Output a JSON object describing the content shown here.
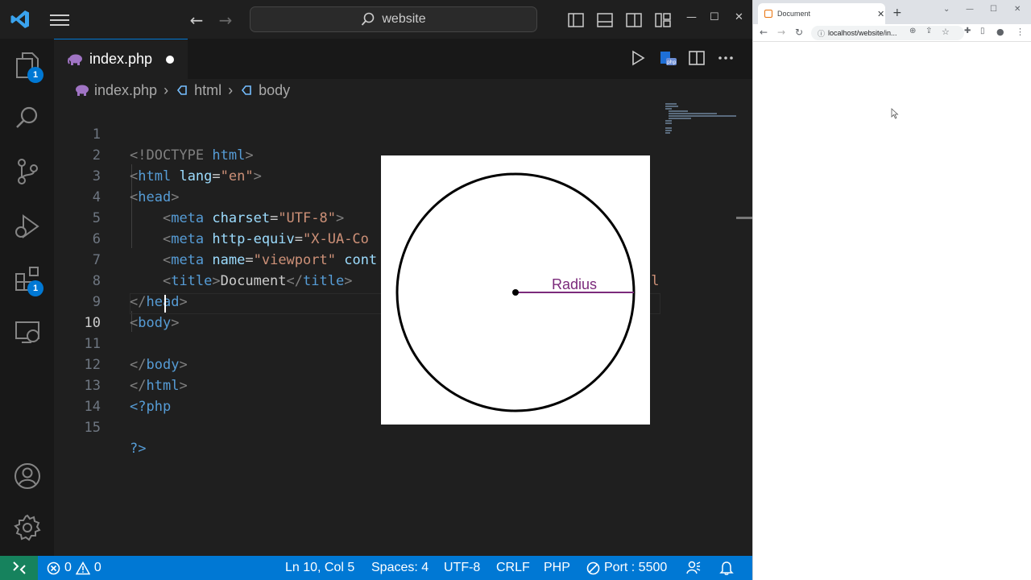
{
  "vscode": {
    "search_text": "website",
    "explorer_badge": "1",
    "extensions_badge": "1",
    "tab": {
      "label": "index.php",
      "modified": true
    },
    "breadcrumb": [
      "index.php",
      "html",
      "body"
    ],
    "lines": [
      {
        "n": "1"
      },
      {
        "n": "2"
      },
      {
        "n": "3"
      },
      {
        "n": "4"
      },
      {
        "n": "5"
      },
      {
        "n": "6"
      },
      {
        "n": "7"
      },
      {
        "n": "8"
      },
      {
        "n": "9"
      },
      {
        "n": "10"
      },
      {
        "n": "11"
      },
      {
        "n": "12"
      },
      {
        "n": "13"
      },
      {
        "n": "14"
      },
      {
        "n": "15"
      }
    ],
    "code": {
      "l1_open": "<!DOCTYPE ",
      "l1_kw": "html",
      "l1_close": ">",
      "l2_tag": "html",
      "l2_attr": "lang",
      "l2_val": "\"en\"",
      "l3_tag": "head",
      "l4_tag": "meta",
      "l4_attr": "charset",
      "l4_val": "\"UTF-8\"",
      "l5_tag": "meta",
      "l5_attr": "http-equiv",
      "l5_val": "\"X-UA-Co",
      "l6_tag": "meta",
      "l6_attr": "name",
      "l6_val": "\"viewport\"",
      "l6_attr2": "cont",
      "l6_tail": "al",
      "l7_tag": "title",
      "l7_text": "Document",
      "l7_endtag": "title",
      "l8_tag": "head",
      "l9_tag": "body",
      "l11_tag": "body",
      "l12_tag": "html",
      "l13_text": "<?php",
      "l15_text": "?>"
    },
    "overlay_label": "Radius",
    "status": {
      "errors": "0",
      "warnings": "0",
      "position": "Ln 10, Col 5",
      "spaces": "Spaces: 4",
      "encoding": "UTF-8",
      "eol": "CRLF",
      "language": "PHP",
      "port": "Port : 5500"
    },
    "colors": {
      "accent": "#0078d4",
      "remote": "#16825d",
      "radius_line": "#7b2a7b"
    }
  },
  "browser": {
    "tab_title": "Document",
    "url": "localhost/website/in..."
  }
}
